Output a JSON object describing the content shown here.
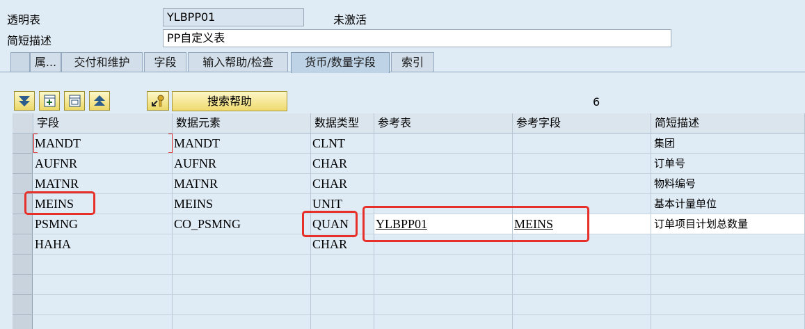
{
  "header": {
    "table_label": "透明表",
    "table_value": "YLBPP01",
    "status": "未激活",
    "desc_label": "简短描述",
    "desc_value": "PP自定义表"
  },
  "tabs": [
    {
      "label": "属..."
    },
    {
      "label": "交付和维护"
    },
    {
      "label": "字段"
    },
    {
      "label": "输入帮助/检查"
    },
    {
      "label": "货币/数量字段",
      "active": true
    },
    {
      "label": "索引"
    }
  ],
  "toolbar": {
    "search_help_label": "搜索帮助",
    "row_count": "6"
  },
  "grid": {
    "columns": [
      "字段",
      "数据元素",
      "数据类型",
      "参考表",
      "参考字段",
      "简短描述"
    ],
    "rows": [
      {
        "field": "MANDT",
        "element": "MANDT",
        "type": "CLNT",
        "ref_table": "",
        "ref_field": "",
        "desc": "集团"
      },
      {
        "field": "AUFNR",
        "element": "AUFNR",
        "type": "CHAR",
        "ref_table": "",
        "ref_field": "",
        "desc": "订单号"
      },
      {
        "field": "MATNR",
        "element": "MATNR",
        "type": "CHAR",
        "ref_table": "",
        "ref_field": "",
        "desc": "物料编号"
      },
      {
        "field": "MEINS",
        "element": "MEINS",
        "type": "UNIT",
        "ref_table": "",
        "ref_field": "",
        "desc": "基本计量单位"
      },
      {
        "field": "PSMNG",
        "element": "CO_PSMNG",
        "type": "QUAN",
        "ref_table": "YLBPP01",
        "ref_field": "MEINS",
        "desc": "订单项目计划总数量"
      },
      {
        "field": "HAHA",
        "element": "",
        "type": "CHAR",
        "ref_table": "",
        "ref_field": "",
        "desc": ""
      }
    ]
  },
  "colors": {
    "background": "#dfebf5",
    "highlight": "#e8302a",
    "button": "#efda6e"
  },
  "icons": [
    "expand-all-icon",
    "insert-row-icon",
    "delete-row-icon",
    "collapse-icon",
    "choose-key-icon"
  ]
}
